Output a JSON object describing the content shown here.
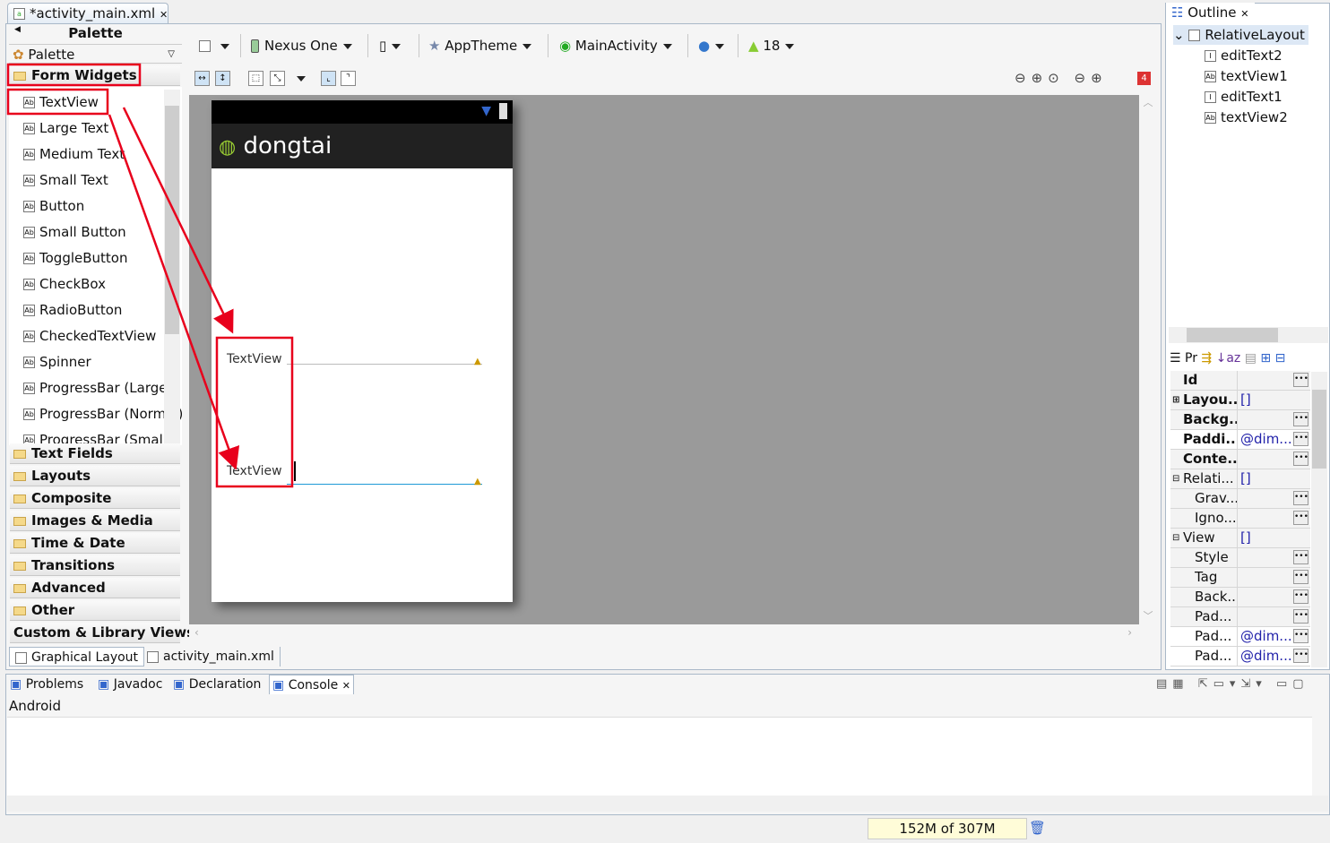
{
  "editor": {
    "tab_title": "*activity_main.xml",
    "bottom_tabs": [
      "Graphical Layout",
      "activity_main.xml"
    ]
  },
  "palette": {
    "header": "Palette",
    "selector": "Palette",
    "open_category": "Form Widgets",
    "items": [
      "TextView",
      "Large Text",
      "Medium Text",
      "Small Text",
      "Button",
      "Small Button",
      "ToggleButton",
      "CheckBox",
      "RadioButton",
      "CheckedTextView",
      "Spinner",
      "ProgressBar (Large)",
      "ProgressBar (Normal)",
      "ProgressBar (Small)"
    ],
    "categories": [
      "Text Fields",
      "Layouts",
      "Composite",
      "Images & Media",
      "Time & Date",
      "Transitions",
      "Advanced",
      "Other",
      "Custom & Library Views"
    ]
  },
  "toolbar": {
    "device": "Nexus One",
    "theme": "AppTheme",
    "activity": "MainActivity",
    "api": "18",
    "error_count": "4"
  },
  "device_preview": {
    "app_title": "dongtai",
    "textviews": [
      "TextView",
      "TextView"
    ]
  },
  "outline": {
    "title": "Outline",
    "root": "RelativeLayout",
    "children": [
      "editText2",
      "textView1",
      "editText1",
      "textView2"
    ]
  },
  "properties": {
    "tab_label": "Pr",
    "rows": [
      {
        "key": "Id",
        "value": "",
        "bold": true
      },
      {
        "key": "Layou...",
        "value": "[]",
        "bold": true,
        "expander": "+"
      },
      {
        "key": "Backg...",
        "value": "",
        "bold": true
      },
      {
        "key": "Paddi...",
        "value": "@dim...",
        "bold": true
      },
      {
        "key": "Conte...",
        "value": "",
        "bold": true
      },
      {
        "key": "Relati...",
        "value": "[]",
        "expander": "-"
      },
      {
        "key": "Grav...",
        "value": "",
        "indent": true
      },
      {
        "key": "Igno...",
        "value": "",
        "indent": true
      },
      {
        "key": "View",
        "value": "[]",
        "expander": "-"
      },
      {
        "key": "Style",
        "value": "",
        "indent": true
      },
      {
        "key": "Tag",
        "value": "",
        "indent": true
      },
      {
        "key": "Back...",
        "value": "",
        "indent": true
      },
      {
        "key": "Pad...",
        "value": "",
        "indent": true
      },
      {
        "key": "Pad...",
        "value": "@dim...",
        "indent": true
      },
      {
        "key": "Pad...",
        "value": "@dim...",
        "indent": true
      }
    ]
  },
  "console": {
    "tabs": [
      "Problems",
      "Javadoc",
      "Declaration",
      "Console"
    ],
    "label": "Android"
  },
  "status": {
    "memory": "152M of 307M"
  },
  "colors": {
    "annotation": "#e8001c",
    "canvas": "#9a9a9a",
    "actionbar": "#212121",
    "selection": "#1e9ad6"
  }
}
